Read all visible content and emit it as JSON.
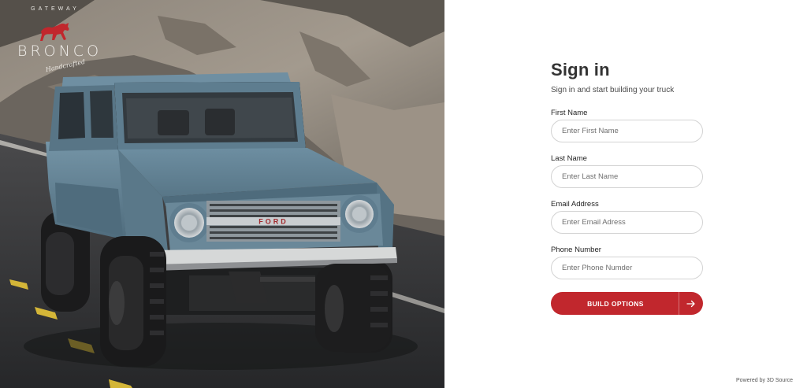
{
  "brand": {
    "arc_text": "GATEWAY",
    "name": "BRONCO",
    "tagline": "Handcrafted",
    "grille_text": "FORD"
  },
  "form": {
    "title": "Sign in",
    "subtitle": "Sign in and start building your truck",
    "first_name": {
      "label": "First Name",
      "placeholder": "Enter First Name"
    },
    "last_name": {
      "label": "Last Name",
      "placeholder": "Enter Last Name"
    },
    "email": {
      "label": "Email Address",
      "placeholder": "Enter Email Adress"
    },
    "phone": {
      "label": "Phone Number",
      "placeholder": "Enter Phone Numder"
    },
    "submit_label": "BUILD OPTIONS"
  },
  "footer": {
    "powered_by": "Powered by 3D Source"
  },
  "icons": {
    "submit_icon": "arrow-right-icon",
    "logo_icon": "horse-icon"
  },
  "colors": {
    "accent": "#c1272d",
    "truck_body": "#5f7f92",
    "text_dark": "#333333"
  }
}
